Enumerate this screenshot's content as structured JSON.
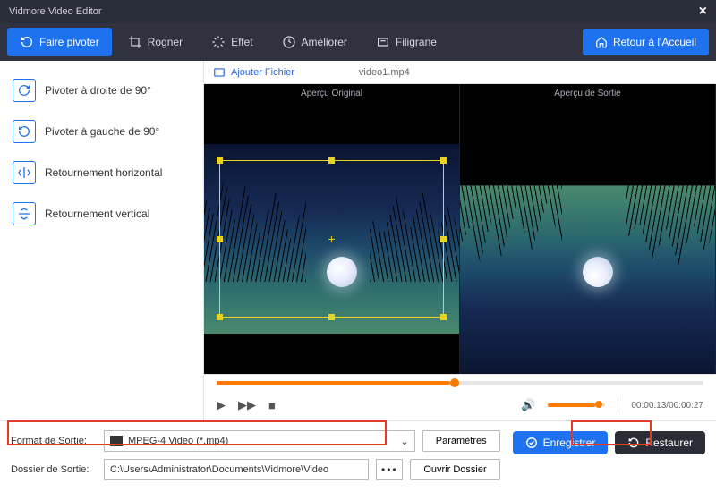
{
  "title": "Vidmore Video Editor",
  "tabs": {
    "rotate": "Faire pivoter",
    "crop": "Rogner",
    "effect": "Effet",
    "enhance": "Améliorer",
    "watermark": "Filigrane"
  },
  "home_button": "Retour à l'Accueil",
  "sidebar": {
    "rotate_right": "Pivoter à droite de 90°",
    "rotate_left": "Pivoter à gauche de 90°",
    "flip_h": "Retournement horizontal",
    "flip_v": "Retournement vertical"
  },
  "file_row": {
    "add_file": "Ajouter Fichier",
    "filename": "video1.mp4"
  },
  "preview": {
    "original": "Aperçu Original",
    "output": "Aperçu de Sortie"
  },
  "time": "00:00:13/00:00:27",
  "output": {
    "format_label": "Format de Sortie:",
    "format_value": "MPEG-4 Video (*.mp4)",
    "settings": "Paramètres",
    "folder_label": "Dossier de Sortie:",
    "folder_value": "C:\\Users\\Administrator\\Documents\\Vidmore\\Video",
    "open_folder": "Ouvrir Dossier"
  },
  "buttons": {
    "save": "Enregistrer",
    "restore": "Restaurer"
  }
}
